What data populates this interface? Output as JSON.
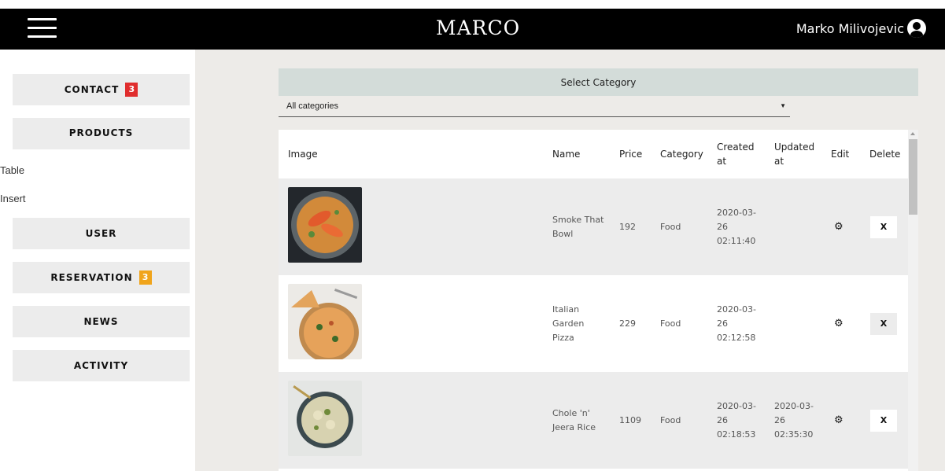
{
  "header": {
    "brand": "MARCO",
    "user_name": "Marko Milivojevic"
  },
  "sidebar": {
    "contact": {
      "label": "CONTACT",
      "badge": "3"
    },
    "products": {
      "label": "PRODUCTS"
    },
    "table_link": "Table",
    "insert_link": "Insert",
    "user": {
      "label": "USER"
    },
    "reservation": {
      "label": "RESERVATION",
      "badge": "3"
    },
    "news": {
      "label": "NEWS"
    },
    "activity": {
      "label": "ACTIVITY"
    }
  },
  "category": {
    "header": "Select Category",
    "selected": "All categories"
  },
  "table": {
    "columns": [
      "Image",
      "Name",
      "Price",
      "Category",
      "Created at",
      "Updated at",
      "Edit",
      "Delete"
    ],
    "rows": [
      {
        "name": "Smoke That Bowl",
        "price": "192",
        "category": "Food",
        "created": "2020-03-26 02:11:40",
        "updated": "",
        "delete": "X"
      },
      {
        "name": "Italian Garden Pizza",
        "price": "229",
        "category": "Food",
        "created": "2020-03-26 02:12:58",
        "updated": "",
        "delete": "X"
      },
      {
        "name": "Chole 'n' Jeera Rice",
        "price": "1109",
        "category": "Food",
        "created": "2020-03-26 02:18:53",
        "updated": "2020-03-26 02:35:30",
        "delete": "X"
      }
    ]
  },
  "colors": {
    "topbar": "#000000",
    "main_bg": "#edebe8",
    "category_header": "#d3dcd9",
    "badge_contact": "#e02d2d",
    "badge_reservation": "#f0a41b"
  },
  "icons": [
    "hamburger-menu-icon",
    "user-circle-icon",
    "gear-icon",
    "dropdown-caret-icon"
  ]
}
